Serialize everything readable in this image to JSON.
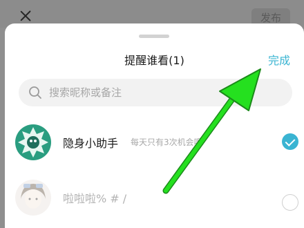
{
  "behind": {
    "publish_label": "发布"
  },
  "sheet": {
    "title": "提醒谁看(1)",
    "done_label": "完成"
  },
  "search": {
    "placeholder": "搜索昵称或备注"
  },
  "contacts": [
    {
      "name": "隐身小助手",
      "hint": "每天只有3次机会哦",
      "selected": true
    },
    {
      "name": "啦啦啦% # /",
      "selected": false
    }
  ],
  "colors": {
    "accent": "#3ab4d2",
    "annotation_arrow": "#25e01f"
  },
  "icons": {
    "close": "close-icon",
    "search": "search-icon",
    "check": "checkmark-icon"
  }
}
